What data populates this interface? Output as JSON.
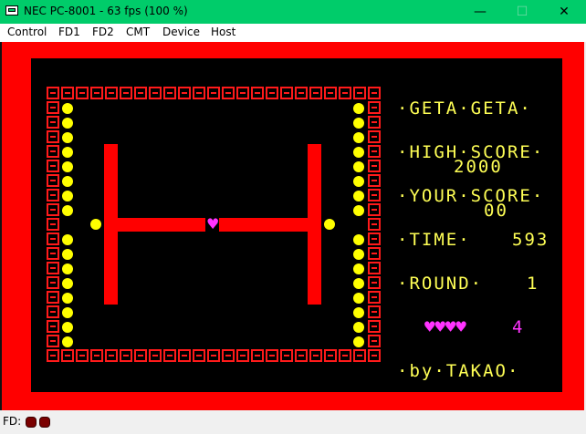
{
  "window": {
    "title": "NEC PC-8001 - 63 fps (100 %)",
    "minimize_glyph": "—",
    "maximize_glyph": "☐",
    "close_glyph": "✕"
  },
  "menu": [
    "Control",
    "FD1",
    "FD2",
    "CMT",
    "Device",
    "Host"
  ],
  "status": {
    "fd_label": "FD:"
  },
  "game": {
    "title": "·GETA·GETA·",
    "high_score_label": "·HIGH·SCORE·",
    "high_score": "2000",
    "your_score_label": "·YOUR·SCORE·",
    "your_score": "00",
    "time_label": "·TIME·",
    "time": "593",
    "round_label": "·ROUND·",
    "round": "1",
    "lives_hearts": "♥♥♥♥",
    "lives": "4",
    "credit": "·by·TAKAO·"
  },
  "colors": {
    "titlebar": "#00cc6a",
    "border": "#ff0000",
    "screen": "#000000",
    "hud_text": "#ffff55",
    "heart": "#ff33ff"
  }
}
